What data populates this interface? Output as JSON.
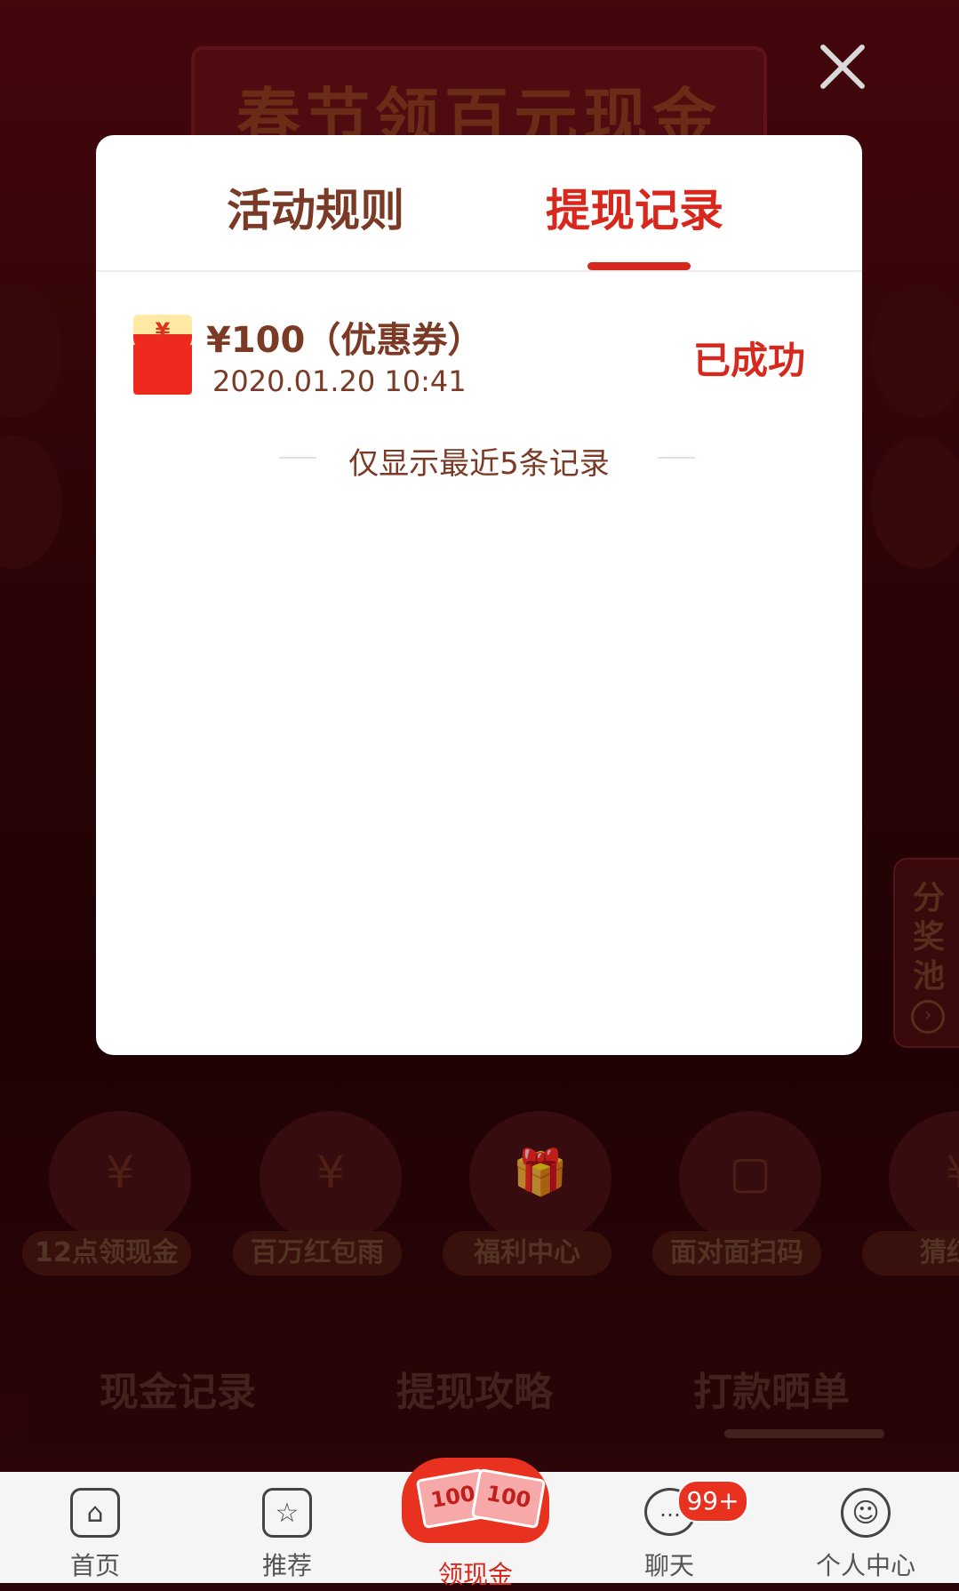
{
  "background": {
    "banner_title": "春节领百元现金",
    "side_tag": {
      "label": "分奖池",
      "arrow": "›"
    },
    "features": [
      {
        "label": "12点领现金",
        "icon": "alarm-clock-icon",
        "glyph": "¥"
      },
      {
        "label": "百万红包雨",
        "icon": "red-packet-icon",
        "glyph": "¥"
      },
      {
        "label": "福利中心",
        "icon": "gift-icon",
        "glyph": "🎁"
      },
      {
        "label": "面对面扫码",
        "icon": "scan-code-icon",
        "glyph": "▢"
      },
      {
        "label": "猜红",
        "icon": "red-packet-icon",
        "glyph": "¥"
      }
    ],
    "tabs": [
      "现金记录",
      "提现攻略",
      "打款晒单"
    ]
  },
  "modal": {
    "close_icon": "close-icon",
    "tabs": [
      {
        "label": "活动规则",
        "active": false
      },
      {
        "label": "提现记录",
        "active": true
      }
    ],
    "records": [
      {
        "amount": "¥100（优惠券）",
        "time": "2020.01.20 10:41",
        "status": "已成功",
        "icon": "red-packet-icon",
        "icon_glyph": "¥"
      }
    ],
    "footnote": "仅显示最近5条记录"
  },
  "bottom_nav": {
    "items": [
      {
        "label": "首页",
        "icon": "home-icon",
        "glyph": "⌂"
      },
      {
        "label": "推荐",
        "icon": "star-icon",
        "glyph": "☆"
      },
      {
        "label": "领现金",
        "icon": "cash-red-packet-icon",
        "active": true,
        "bill_a": "100",
        "bill_b": "100"
      },
      {
        "label": "聊天",
        "icon": "chat-icon",
        "glyph": "…",
        "badge": "99+"
      },
      {
        "label": "个人中心",
        "icon": "profile-icon",
        "glyph": "☺"
      }
    ]
  },
  "colors": {
    "accent": "#d8281e",
    "text_brown": "#7a3a25",
    "overlay_bg": "#3a0509"
  }
}
